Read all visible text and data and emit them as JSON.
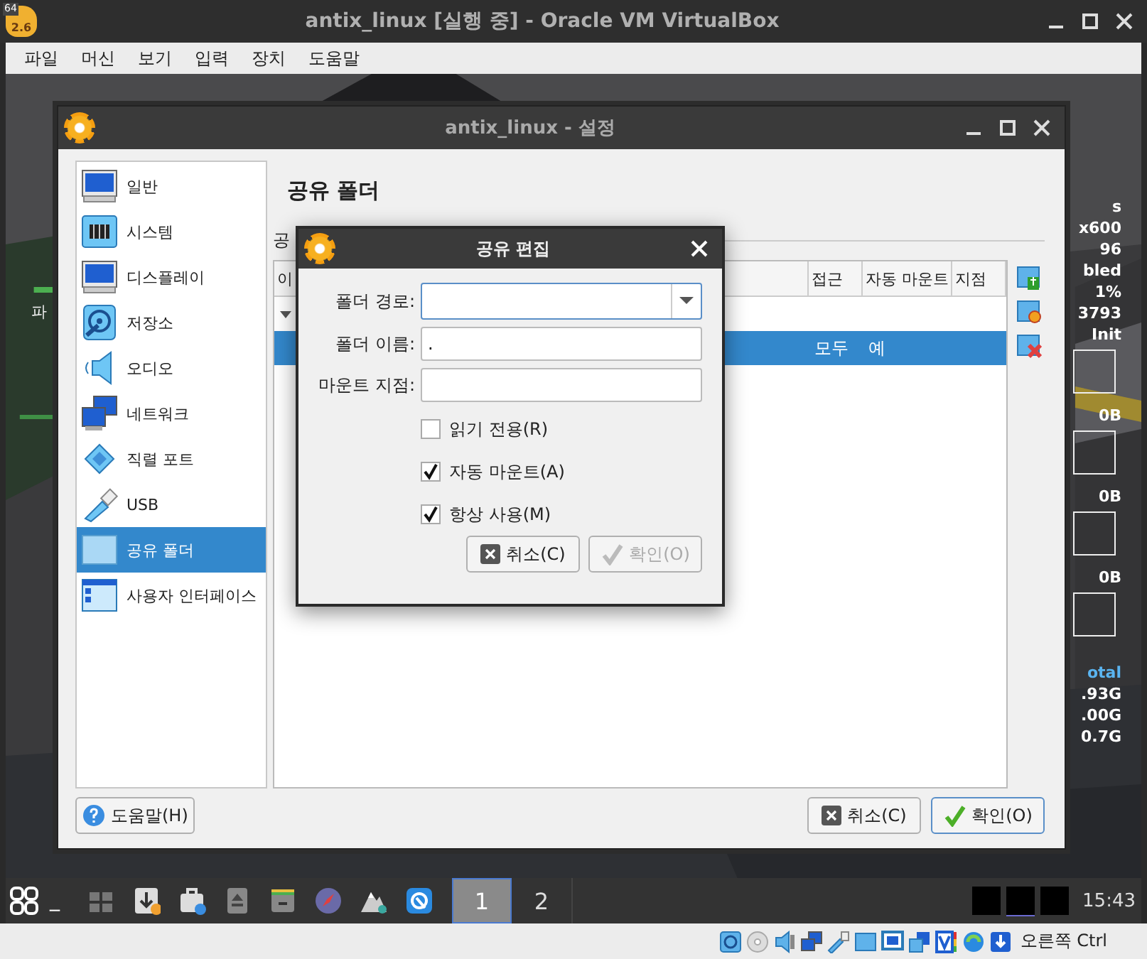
{
  "window": {
    "title": "antix_linux [실행 중] - Oracle VM VirtualBox",
    "app_badge": "64",
    "app_version": "2.6"
  },
  "menu": [
    "파일",
    "머신",
    "보기",
    "입력",
    "장치",
    "도움말"
  ],
  "desktop": {
    "left_fragment": "파",
    "conky": [
      {
        "text": "s",
        "kind": "text"
      },
      {
        "text": "x600",
        "kind": "text"
      },
      {
        "text": "96",
        "kind": "text"
      },
      {
        "text": "bled",
        "kind": "text"
      },
      {
        "text": "1%",
        "kind": "text"
      },
      {
        "text": "3793",
        "kind": "text"
      },
      {
        "text": "Init",
        "kind": "text"
      },
      {
        "kind": "graph"
      },
      {
        "text": "0B",
        "kind": "text"
      },
      {
        "kind": "graph"
      },
      {
        "text": "0B",
        "kind": "text"
      },
      {
        "kind": "graph"
      },
      {
        "text": "0B",
        "kind": "text"
      },
      {
        "kind": "graph"
      },
      {
        "text": "otal",
        "kind": "heading"
      },
      {
        "text": ".93G",
        "kind": "text"
      },
      {
        "text": ".00G",
        "kind": "text"
      },
      {
        "text": "0.7G",
        "kind": "text"
      }
    ]
  },
  "settings": {
    "title": "antix_linux - 설정",
    "sidebar": [
      {
        "label": "일반",
        "selected": false
      },
      {
        "label": "시스템",
        "selected": false
      },
      {
        "label": "디스플레이",
        "selected": false
      },
      {
        "label": "저장소",
        "selected": false
      },
      {
        "label": "오디오",
        "selected": false
      },
      {
        "label": "네트워크",
        "selected": false
      },
      {
        "label": "직렬 포트",
        "selected": false
      },
      {
        "label": "USB",
        "selected": false
      },
      {
        "label": "공유 폴더",
        "selected": true
      },
      {
        "label": "사용자 인터페이스",
        "selected": false
      }
    ],
    "heading": "공유 폴더",
    "group_label": "공",
    "columns": [
      "이",
      "접근",
      "자동 마운트",
      "지점"
    ],
    "rows": [
      {
        "kind": "group",
        "expanded": true,
        "selected": false
      },
      {
        "kind": "item",
        "selected": true,
        "access": "모두",
        "auto_mount": "예"
      }
    ],
    "help_button": "도움말(H)",
    "buttons": [
      {
        "label": "취소(C)",
        "kind": "cancel"
      },
      {
        "label": "확인(O)",
        "kind": "ok"
      }
    ]
  },
  "dialog": {
    "title": "공유 편집",
    "fields": [
      {
        "label": "폴더 경로:",
        "kind": "combo"
      },
      {
        "label": "폴더 이름:",
        "kind": "text",
        "value": "."
      },
      {
        "label": "마운트 지점:",
        "kind": "text"
      }
    ],
    "checkboxes": [
      {
        "label": "읽기 전용(R)",
        "checked": false
      },
      {
        "label": "자동 마운트(A)",
        "checked": true
      },
      {
        "label": "항상 사용(M)",
        "checked": true
      }
    ],
    "buttons": [
      {
        "label": "취소(C)",
        "kind": "cancel",
        "disabled": false
      },
      {
        "label": "확인(O)",
        "kind": "ok",
        "disabled": true
      }
    ]
  },
  "taskbar": {
    "minimize_glyph": "_",
    "workspaces": [
      {
        "label": "1",
        "selected": true
      },
      {
        "label": "2",
        "selected": false
      }
    ],
    "clock": "15:43"
  },
  "statusbar": {
    "host_key": "오른쪽 Ctrl"
  }
}
